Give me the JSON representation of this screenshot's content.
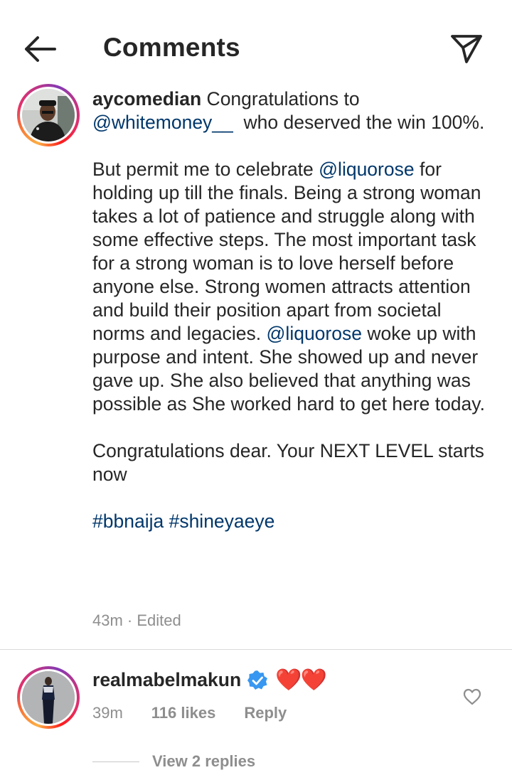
{
  "header": {
    "title": "Comments",
    "back_icon": "arrow-left-icon",
    "share_icon": "paper-plane-icon"
  },
  "post": {
    "username": "aycomedian",
    "text_1": " Congratulations to",
    "mention_1": "@whitemoney__",
    "text_2": "  who deserved the win 100%.",
    "para2_text_a": "But permit me to celebrate ",
    "mention_2": "@liquorose",
    "para2_text_b": " for holding up till the finals. Being a strong woman takes a lot of patience and struggle along with some effective steps. The most important task for a strong woman is to love herself before anyone else. Strong women attracts attention and build their position apart from societal norms and legacies. ",
    "mention_3": "@liquorose",
    "para2_text_c": " woke up with purpose and intent. She showed up and never gave up. She also believed that anything was possible as She worked hard to get here today.",
    "para3_text": "Congratulations dear. Your NEXT LEVEL starts now",
    "hashtag_1": "#bbnaija",
    "hashtag_2": "#shineyaeye",
    "time": "43m",
    "separator": " · ",
    "edited": "Edited"
  },
  "reply": {
    "username": "realmabelmakun",
    "verified_icon": "verified-badge-icon",
    "text": "❤️❤️",
    "time": "39m",
    "likes": "116 likes",
    "reply_label": "Reply",
    "like_icon": "heart-outline-icon",
    "view_replies": "View 2 replies"
  },
  "colors": {
    "link": "#00376b",
    "meta": "#8e8e8e",
    "verified": "#3897f0",
    "heart": "#e0182d"
  }
}
